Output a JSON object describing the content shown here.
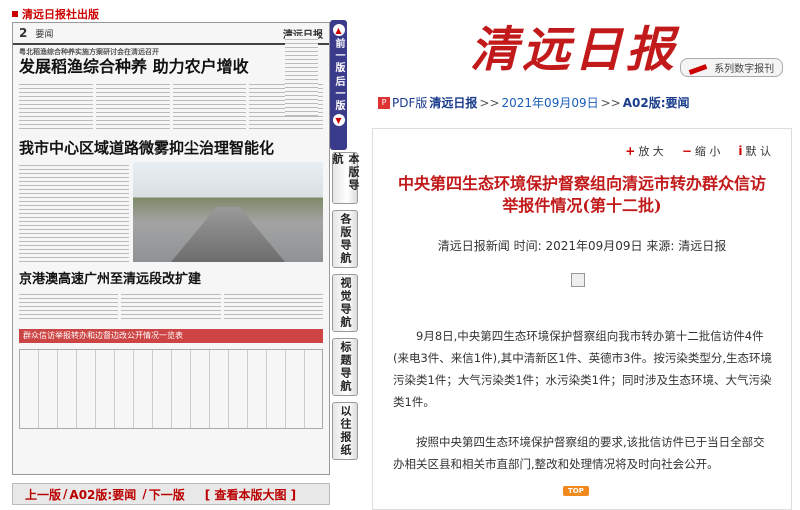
{
  "header": {
    "publisher": "清远日报社出版"
  },
  "newspaper": {
    "page_number": "2",
    "section": "要闻",
    "masthead": "清远日报",
    "subhead": "粤北稻渔综合种养实施方案研讨会在清远召开",
    "headline_1": "发展稻渔综合种养 助力农户增收",
    "headline_2": "我市中心区域道路微雾抑尘治理智能化",
    "headline_3": "京港澳高速广州至清远段改扩建",
    "banner": "群众信访举报转办和边督边改公开情况一览表"
  },
  "strip": {
    "prev": "前一版",
    "next": "后一版"
  },
  "vnav": [
    {
      "label": "本版导航"
    },
    {
      "label": "各版导航"
    },
    {
      "label": "视觉导航"
    },
    {
      "label": "标题导航"
    },
    {
      "label": "以往报纸"
    }
  ],
  "bottom_nav": {
    "prev": "上一版",
    "current": "A02版:要闻",
    "next": "下一版",
    "big": "[ 查看本版大图 ]"
  },
  "logo": {
    "text": "清远日报",
    "tag": "系列数字报刊"
  },
  "breadcrumb": {
    "pdf": "PDF版",
    "paper": "清远日报",
    "date": "2021年09月09日",
    "page": "A02版:要闻"
  },
  "font_controls": {
    "enlarge": "放 大",
    "shrink": "缩 小",
    "default": "默 认"
  },
  "article": {
    "title": "中央第四生态环境保护督察组向清远市转办群众信访举报件情况(第十二批)",
    "meta": "清远日报新闻 时间: 2021年09月09日 来源: 清远日报",
    "paragraphs": [
      "9月8日,中央第四生态环境保护督察组向我市转办第十二批信访件4件(来电3件、来信1件),其中清新区1件、英德市3件。按污染类型分,生态环境污染类1件；大气污染类1件；水污染类1件；同时涉及生态环境、大气污染类1件。",
      "按照中央第四生态环境保护督察组的要求,该批信访件已于当日全部交办相关区县和相关市直部门,整改和处理情况将及时向社会公开。"
    ],
    "top_label": "TOP"
  }
}
